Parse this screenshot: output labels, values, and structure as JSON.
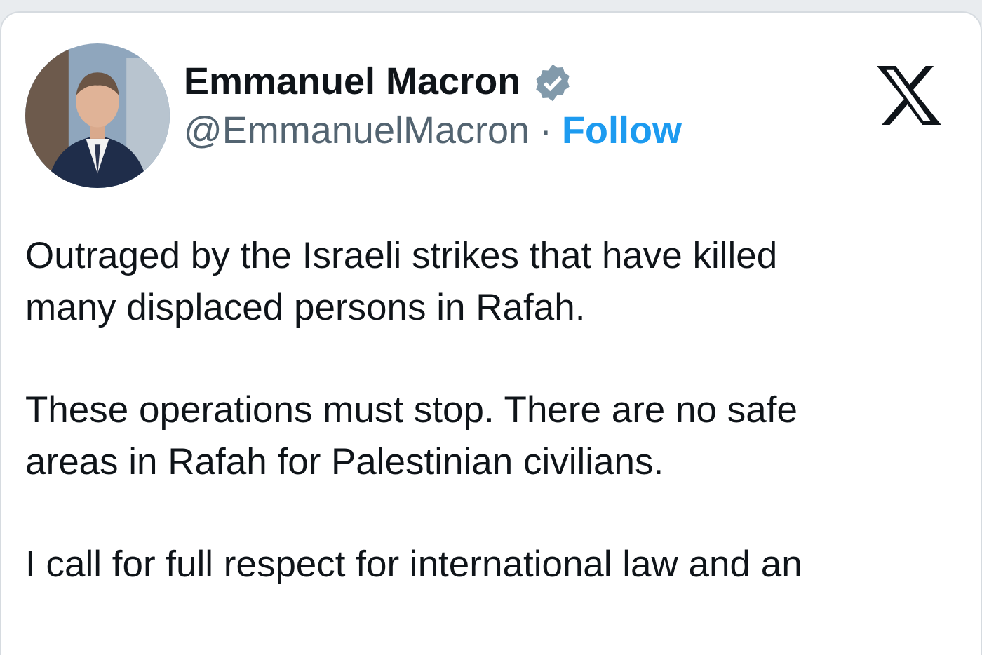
{
  "author": {
    "name": "Emmanuel Macron",
    "verified": true,
    "handle": "@EmmanuelMacron",
    "separator": "·",
    "follow": "Follow"
  },
  "paragraphs": [
    {
      "lines": [
        "Outraged by the Israeli strikes that have killed",
        "many displaced persons in Rafah."
      ]
    },
    {
      "lines": [
        "These operations must stop. There are no safe",
        "areas in Rafah for Palestinian civilians."
      ]
    },
    {
      "lines": [
        "I call for full respect for international law and an"
      ]
    }
  ]
}
